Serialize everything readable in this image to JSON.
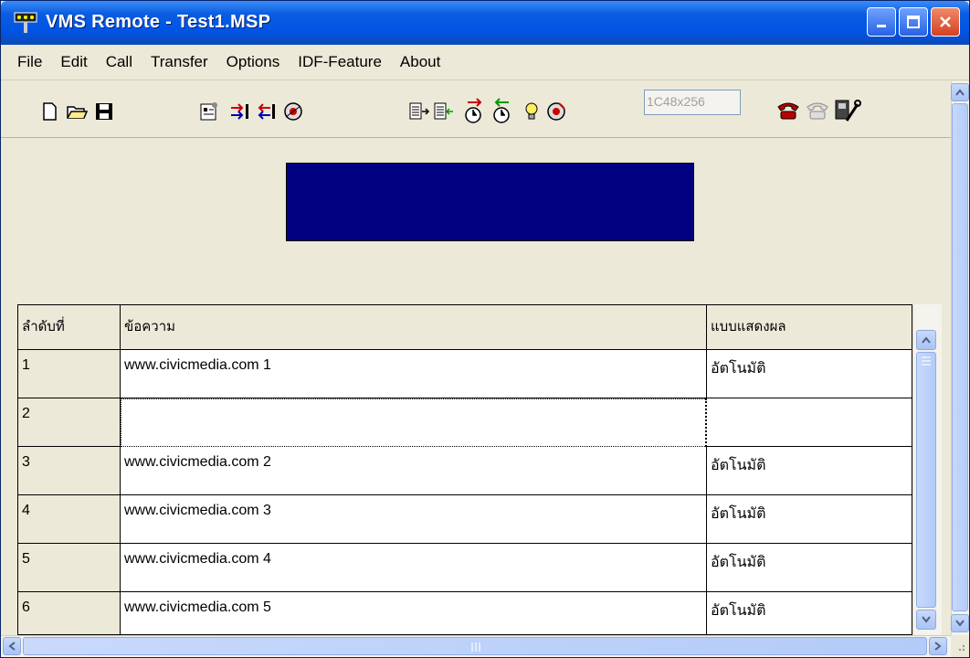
{
  "window": {
    "title": "VMS Remote - Test1.MSP"
  },
  "menu": [
    "File",
    "Edit",
    "Call",
    "Transfer",
    "Options",
    "IDF-Feature",
    "About"
  ],
  "toolbar": {
    "size_combo_value": "1C48x256",
    "icons": [
      "new-file-icon",
      "open-folder-icon",
      "save-disk-icon",
      "properties-icon",
      "send-icon",
      "receive-icon",
      "monitor-icon",
      "copy-to-icon",
      "copy-from-icon",
      "timer-send-icon",
      "timer-receive-icon",
      "brightness-icon",
      "reset-icon",
      "phone-dial-icon",
      "phone-hangup-icon",
      "settings-tools-icon"
    ]
  },
  "display": {
    "background_color": "#000080"
  },
  "grid": {
    "headers": [
      "ลำดับที่",
      "ข้อความ",
      "แบบแสดงผล"
    ],
    "rows": [
      {
        "num": "1",
        "message": "www.civicmedia.com 1",
        "mode": "อัตโนมัติ"
      },
      {
        "num": "2",
        "message": "",
        "mode": ""
      },
      {
        "num": "3",
        "message": "www.civicmedia.com 2",
        "mode": "อัตโนมัติ"
      },
      {
        "num": "4",
        "message": "www.civicmedia.com 3",
        "mode": "อัตโนมัติ"
      },
      {
        "num": "5",
        "message": "www.civicmedia.com 4",
        "mode": "อัตโนมัติ"
      },
      {
        "num": "6",
        "message": "www.civicmedia.com 5",
        "mode": "อัตโนมัติ"
      }
    ]
  }
}
